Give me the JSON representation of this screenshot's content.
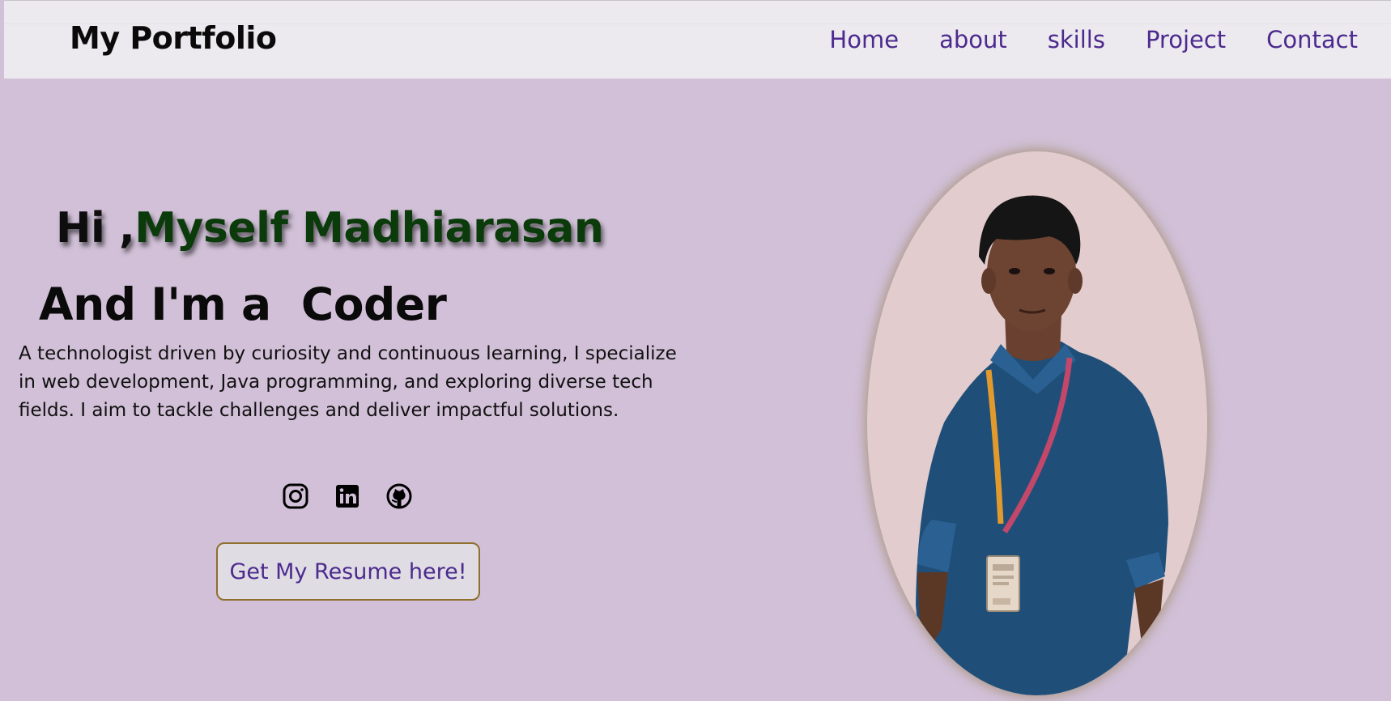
{
  "brand": "My Portfolio",
  "nav": {
    "home": "Home",
    "about": "about",
    "skills": "skills",
    "project": "Project",
    "contact": "Contact"
  },
  "hero": {
    "greeting": "Hi ,",
    "name": "Myself Madhiarasan",
    "subtitle": "And I'm a  Coder",
    "description": "A technologist driven by curiosity and continuous learning, I specialize in web development, Java programming, and exploring diverse tech fields. I aim to tackle challenges and deliver impactful solutions."
  },
  "socials": [
    {
      "icon": "instagram-icon"
    },
    {
      "icon": "linkedin-icon"
    },
    {
      "icon": "github-icon"
    }
  ],
  "resume_button": "Get My Resume here!",
  "colors": {
    "background": "#d1c0d7",
    "navbar": "#edeaef",
    "nav_link": "#4c2a8e",
    "name_accent": "#0b3b0b",
    "button_border": "#8f6f2e"
  }
}
